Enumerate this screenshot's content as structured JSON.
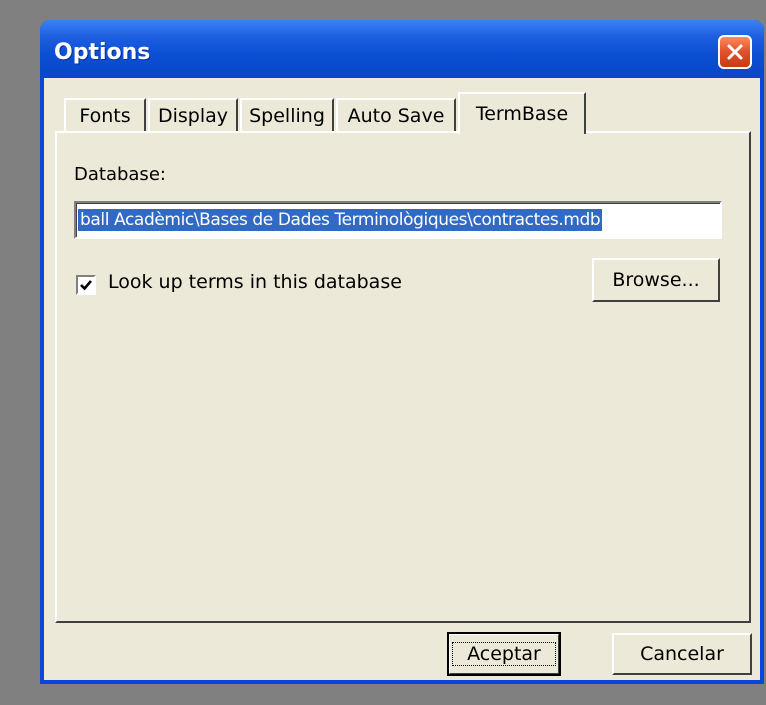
{
  "window": {
    "title": "Options"
  },
  "tabs": [
    {
      "label": "Fonts",
      "active": false
    },
    {
      "label": "Display",
      "active": false
    },
    {
      "label": "Spelling",
      "active": false
    },
    {
      "label": "Auto Save",
      "active": false
    },
    {
      "label": "TermBase",
      "active": true
    }
  ],
  "termbase": {
    "database_label": "Database:",
    "database_value": "ball Acadèmic\\Bases de Dades Terminològiques\\contractes.mdb",
    "lookup_label": "Look up terms in this database",
    "lookup_checked": true,
    "browse_label": "Browse..."
  },
  "footer": {
    "accept_label": "Aceptar",
    "cancel_label": "Cancelar"
  },
  "colors": {
    "titlebar": "#0a47d8",
    "face": "#ece9d8",
    "selection": "#316ac5",
    "close": "#e0502a"
  }
}
